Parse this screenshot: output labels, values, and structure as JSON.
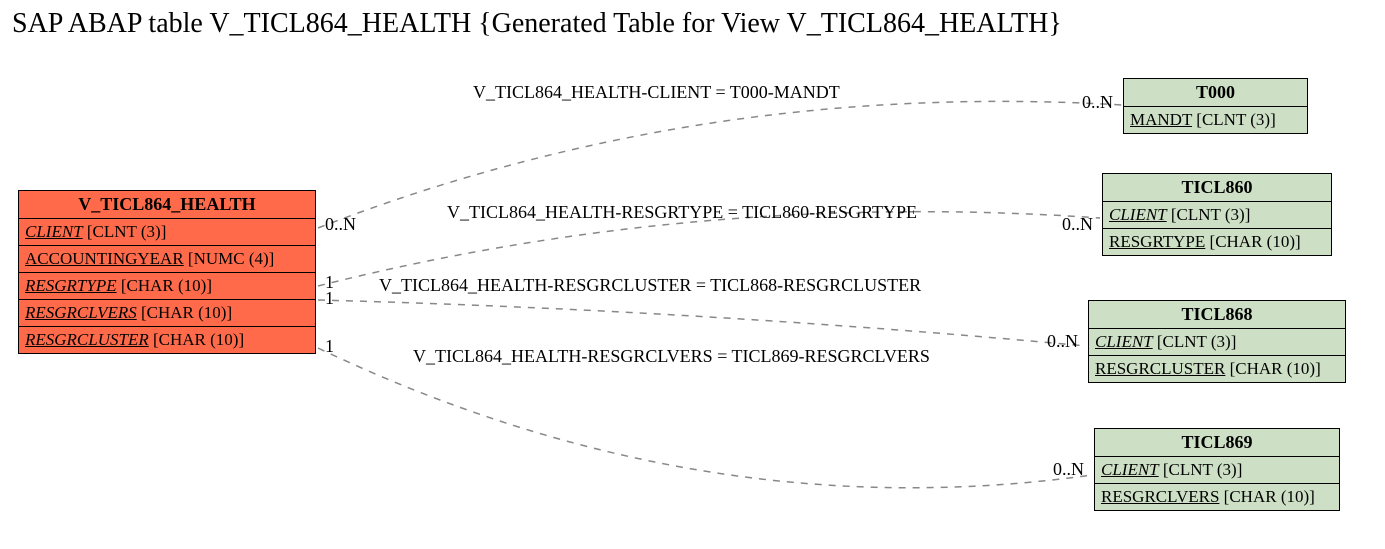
{
  "title": "SAP ABAP table V_TICL864_HEALTH {Generated Table for View V_TICL864_HEALTH}",
  "main": {
    "name": "V_TICL864_HEALTH",
    "fields": [
      {
        "name": "CLIENT",
        "type": "[CLNT (3)]",
        "underline": true,
        "italic": true
      },
      {
        "name": "ACCOUNTINGYEAR",
        "type": "[NUMC (4)]",
        "underline": true,
        "italic": false
      },
      {
        "name": "RESGRTYPE",
        "type": "[CHAR (10)]",
        "underline": true,
        "italic": true
      },
      {
        "name": "RESGRCLVERS",
        "type": "[CHAR (10)]",
        "underline": true,
        "italic": true
      },
      {
        "name": "RESGRCLUSTER",
        "type": "[CHAR (10)]",
        "underline": true,
        "italic": true
      }
    ]
  },
  "refs": {
    "t000": {
      "name": "T000",
      "fields": [
        {
          "name": "MANDT",
          "type": "[CLNT (3)]",
          "underline": true,
          "italic": false
        }
      ]
    },
    "ticl860": {
      "name": "TICL860",
      "fields": [
        {
          "name": "CLIENT",
          "type": "[CLNT (3)]",
          "underline": true,
          "italic": true
        },
        {
          "name": "RESGRTYPE",
          "type": "[CHAR (10)]",
          "underline": true,
          "italic": false
        }
      ]
    },
    "ticl868": {
      "name": "TICL868",
      "fields": [
        {
          "name": "CLIENT",
          "type": "[CLNT (3)]",
          "underline": true,
          "italic": true
        },
        {
          "name": "RESGRCLUSTER",
          "type": "[CHAR (10)]",
          "underline": true,
          "italic": false
        }
      ]
    },
    "ticl869": {
      "name": "TICL869",
      "fields": [
        {
          "name": "CLIENT",
          "type": "[CLNT (3)]",
          "underline": true,
          "italic": true
        },
        {
          "name": "RESGRCLVERS",
          "type": "[CHAR (10)]",
          "underline": true,
          "italic": false
        }
      ]
    }
  },
  "edges": {
    "e1": {
      "label": "V_TICL864_HEALTH-CLIENT = T000-MANDT",
      "left": "0..N",
      "right": "0..N"
    },
    "e2": {
      "label": "V_TICL864_HEALTH-RESGRTYPE = TICL860-RESGRTYPE",
      "left": "1",
      "right": "0..N"
    },
    "e3": {
      "label": "V_TICL864_HEALTH-RESGRCLUSTER = TICL868-RESGRCLUSTER",
      "left": "1",
      "right": "0..N"
    },
    "e4": {
      "label": "V_TICL864_HEALTH-RESGRCLVERS = TICL869-RESGRCLVERS",
      "left": "1",
      "right": "0..N"
    }
  }
}
